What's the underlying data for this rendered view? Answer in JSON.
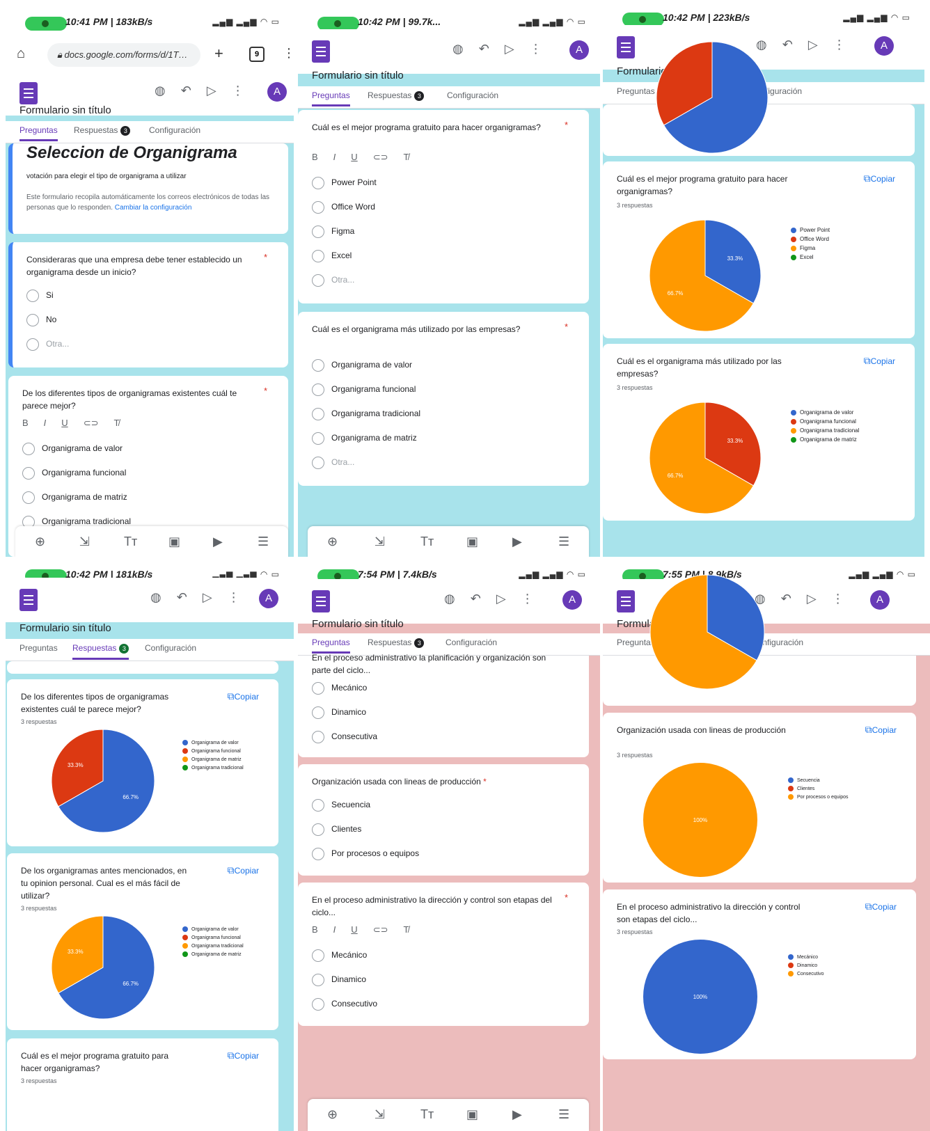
{
  "panels": [
    {
      "status_time": "10:41 PM | 183kB/s",
      "browser_url": "docs.google.com/forms/d/1T…",
      "tab_count": "9"
    },
    {
      "status_time": "10:42 PM | 99.7k..."
    },
    {
      "status_time": "10:42 PM | 223kB/s"
    },
    {
      "status_time": "10:42 PM | 181kB/s"
    },
    {
      "status_time": "7:54 PM | 7.4kB/s"
    },
    {
      "status_time": "7:55 PM | 8.9kB/s"
    }
  ],
  "app": {
    "form_title": "Formulario sin título",
    "avatar_letter": "A",
    "tabs": {
      "questions": "Preguntas",
      "responses": "Respuestas",
      "settings": "Configuración",
      "badge": "3"
    }
  },
  "copy_label": "Copiar",
  "responses_label": "3 respuestas",
  "p1": {
    "title": "Seleccion de Organigrama",
    "description": "votación para elegir el tipo de organigrama a utilizar",
    "note": "Este formulario recopila automáticamente los correos electrónicos de todas las personas que lo responden.",
    "note_link": "Cambiar la configuración",
    "q1": "Consideraras que una empresa debe tener establecido un organigrama desde un inicio?",
    "q1_options": [
      "Si",
      "No",
      "Otra..."
    ],
    "q2": "De los diferentes tipos de organigramas existentes cuál te parece mejor?",
    "q2_options": [
      "Organigrama de valor",
      "Organigrama funcional",
      "Organigrama de matriz",
      "Organigrama tradicional"
    ]
  },
  "p2": {
    "q1": "Cuál es el mejor programa gratuito para hacer organigramas?",
    "q1_options": [
      "Power Point",
      "Office Word",
      "Figma",
      "Excel",
      "Otra..."
    ],
    "q2": "Cuál es el organigrama más utilizado por las empresas?",
    "q2_options": [
      "Organigrama de valor",
      "Organigrama funcional",
      "Organigrama tradicional",
      "Organigrama de matriz",
      "Otra..."
    ]
  },
  "p3": {
    "c1": {
      "title": "Cuál es el mejor programa gratuito para hacer organigramas?",
      "legend": [
        "Power Point",
        "Office Word",
        "Figma",
        "Excel"
      ]
    },
    "c2": {
      "title": "Cuál es el organigrama más utilizado por las empresas?",
      "legend": [
        "Organigrama de valor",
        "Organigrama funcional",
        "Organigrama tradicional",
        "Organigrama de matriz"
      ]
    }
  },
  "p4": {
    "c1": {
      "title": "De los diferentes tipos de organigramas existentes cuál te parece mejor?",
      "legend": [
        "Organigrama de valor",
        "Organigrama funcional",
        "Organigrama de matriz",
        "Organigrama tradicional"
      ]
    },
    "c2": {
      "title": "De los organigramas antes mencionados, en tu opinion personal. Cual es el más fácil de utilizar?",
      "legend": [
        "Organigrama de valor",
        "Organigrama funcional",
        "Organigrama tradicional",
        "Organigrama de matriz"
      ]
    },
    "c3": {
      "title": "Cuál es el mejor programa gratuito para hacer organigramas?"
    }
  },
  "p5": {
    "top_text": "En el proceso administrativo la planificación y organización son parte del ciclo...",
    "top_options": [
      "Mecánico",
      "Dinamico",
      "Consecutiva"
    ],
    "q2": "Organización usada con lineas de producción",
    "q2_options": [
      "Secuencia",
      "Clientes",
      "Por procesos o equipos"
    ],
    "q3": "En el proceso administrativo la dirección y control son etapas del ciclo...",
    "q3_options": [
      "Mecánico",
      "Dinamico",
      "Consecutivo"
    ]
  },
  "p6": {
    "c1": {
      "title": "Organización usada con lineas de producción",
      "legend": [
        "Secuencia",
        "Clientes",
        "Por procesos o equipos"
      ]
    },
    "c2": {
      "title": "En el proceso administrativo la dirección y control son etapas del ciclo...",
      "legend": [
        "Mecánico",
        "Dinamico",
        "Consecutivo"
      ]
    }
  },
  "colors": {
    "blue": "#3366cc",
    "red": "#dc3912",
    "orange": "#ff9900",
    "green": "#109618",
    "teal": "#a8e3eb",
    "pink": "#ecbcbc",
    "purple": "#673ab7"
  },
  "chart_data": [
    {
      "type": "pie",
      "title": "Cuál es el mejor programa gratuito para hacer organigramas?",
      "categories": [
        "Power Point",
        "Office Word",
        "Figma",
        "Excel"
      ],
      "values": [
        33.3,
        0,
        66.7,
        0
      ]
    },
    {
      "type": "pie",
      "title": "Cuál es el organigrama más utilizado por las empresas?",
      "categories": [
        "Organigrama de valor",
        "Organigrama funcional",
        "Organigrama tradicional",
        "Organigrama de matriz"
      ],
      "values": [
        0,
        33.3,
        66.7,
        0
      ]
    },
    {
      "type": "pie",
      "title": "De los diferentes tipos de organigramas existentes cuál te parece mejor?",
      "categories": [
        "Organigrama de valor",
        "Organigrama funcional",
        "Organigrama de matriz",
        "Organigrama tradicional"
      ],
      "values": [
        66.7,
        33.3,
        0,
        0
      ]
    },
    {
      "type": "pie",
      "title": "De los organigramas antes mencionados, en tu opinion personal. Cual es el más fácil de utilizar?",
      "categories": [
        "Organigrama de valor",
        "Organigrama funcional",
        "Organigrama tradicional",
        "Organigrama de matriz"
      ],
      "values": [
        66.7,
        0,
        33.3,
        0
      ]
    },
    {
      "type": "pie",
      "title": "Organización usada con lineas de producción",
      "categories": [
        "Secuencia",
        "Clientes",
        "Por procesos o equipos"
      ],
      "values": [
        0,
        0,
        100
      ]
    },
    {
      "type": "pie",
      "title": "En el proceso administrativo la dirección y control son etapas del ciclo...",
      "categories": [
        "Mecánico",
        "Dinamico",
        "Consecutivo"
      ],
      "values": [
        100,
        0,
        0
      ]
    }
  ]
}
